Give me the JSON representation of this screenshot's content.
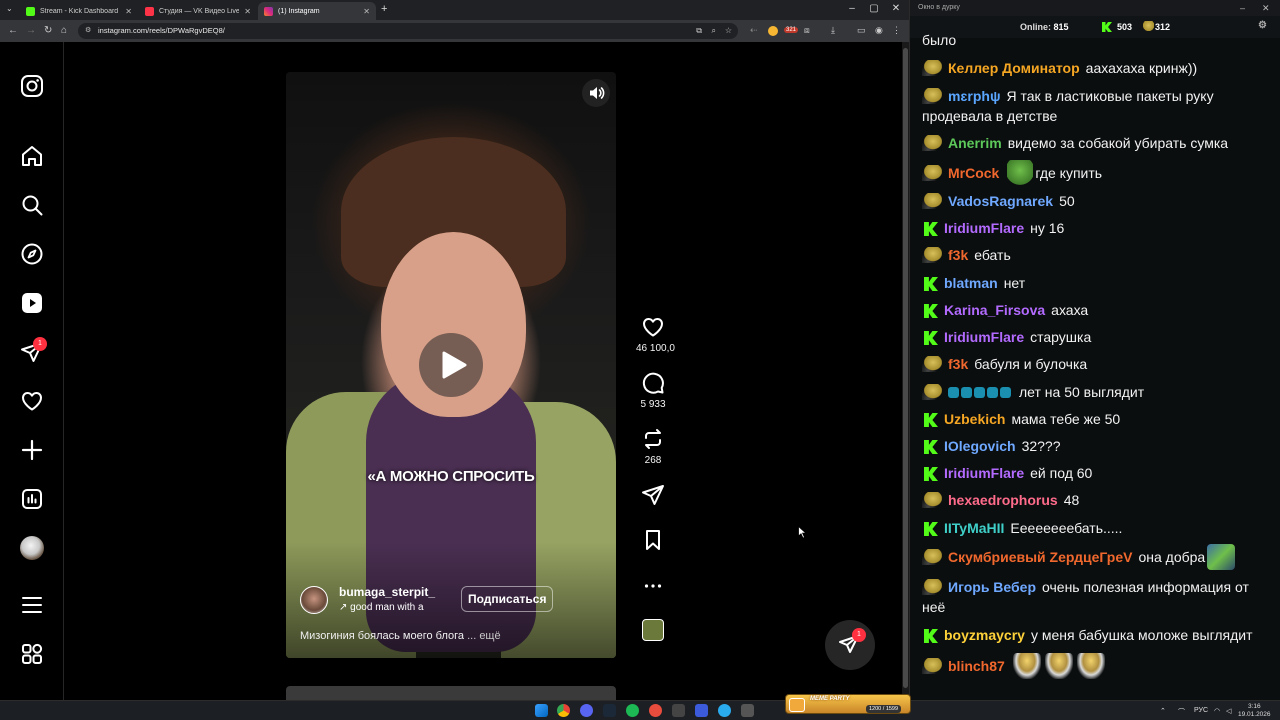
{
  "browser": {
    "tabs": [
      {
        "label": "Stream - Kick Dashboard",
        "color": "#53fc18"
      },
      {
        "label": "Студия — VK Видео Live",
        "color": "#ff3347"
      },
      {
        "label": "(1) Instagram",
        "color": "#e1306c"
      }
    ],
    "url": "instagram.com/reels/DPWaRgvDEQ8/",
    "ext_badge": "321"
  },
  "instagram": {
    "sidebar_badge": "1",
    "reel": {
      "overlay_text": "«А МОЖНО СПРОСИТЬ",
      "author": "bumaga_sterpit_",
      "audio": "good man with a",
      "follow_label": "Подписаться",
      "caption": "Мизогиния боялась моего блога",
      "caption_more": "... ещё"
    },
    "actions": {
      "likes": "46 100,0",
      "comments": "5 933",
      "reposts": "268"
    },
    "dm_badge": "1"
  },
  "chat": {
    "title": "Окно в дурку",
    "online_label": "Online:",
    "online_value": "815",
    "kick_count": "503",
    "vk_count": "312",
    "messages": [
      {
        "user": "",
        "text": "было",
        "icon": "none",
        "color": "#ffffff"
      },
      {
        "user": "Келлер Доминатор",
        "text": "аахахаха кринж))",
        "icon": "pepe",
        "color": "#f5a623"
      },
      {
        "user": "mɛrphψ",
        "text": "Я так в ластиковые пакеты руку продевала в детстве",
        "icon": "pepe",
        "color": "#5aa6ff"
      },
      {
        "user": "Anerrim",
        "text": "видемо за собакой убирать сумка",
        "icon": "pepe",
        "color": "#5cc95a"
      },
      {
        "user": "MrCock",
        "text": "где купить",
        "icon": "pepe",
        "color": "#f0682d"
      },
      {
        "user": "VadosRagnarek",
        "text": "50",
        "icon": "pepe",
        "color": "#6fa8ff"
      },
      {
        "user": "IridiumFlare",
        "text": "ну 16",
        "icon": "kick",
        "color": "#b36bff"
      },
      {
        "user": "f3k",
        "text": "ебать",
        "icon": "pepe",
        "color": "#f0682d"
      },
      {
        "user": "blatman",
        "text": "нет",
        "icon": "kick",
        "color": "#6fa8ff"
      },
      {
        "user": "Karina_Firsova",
        "text": "ахаха",
        "icon": "kick",
        "color": "#b36bff"
      },
      {
        "user": "IridiumFlare",
        "text": "старушка",
        "icon": "kick",
        "color": "#b36bff"
      },
      {
        "user": "f3k",
        "text": "бабуля и булочка",
        "icon": "pepe",
        "color": "#f0682d"
      },
      {
        "user": "",
        "text": "лет на 50 выглядит",
        "icon": "pepe",
        "color": "#1a8fb0"
      },
      {
        "user": "Uzbekich",
        "text": "мама тебе же 50",
        "icon": "kick",
        "color": "#f5a623"
      },
      {
        "user": "IOlegovich",
        "text": "32???",
        "icon": "kick",
        "color": "#6fa8ff"
      },
      {
        "user": "IridiumFlare",
        "text": "ей под 60",
        "icon": "kick",
        "color": "#b36bff"
      },
      {
        "user": "hexaedrophorus",
        "text": "48",
        "icon": "pepe",
        "color": "#ff6b8b"
      },
      {
        "user": "IITyMaHII",
        "text": "Еееееееебать.....",
        "icon": "kick",
        "color": "#3fd0c9"
      },
      {
        "user": "Скумбриевый ZердцеГреV",
        "text": "она добра",
        "icon": "pepe",
        "color": "#f0682d"
      },
      {
        "user": "Игорь Вебер",
        "text": "очень полезная информация от неё",
        "icon": "pepe",
        "color": "#6fa8ff"
      },
      {
        "user": "boyzmaycry",
        "text": "у меня бабушка моложе выглядит",
        "icon": "kick",
        "color": "#ffd23a"
      },
      {
        "user": "blinch87",
        "text": "",
        "icon": "pepe",
        "color": "#f0682d"
      }
    ]
  },
  "taskbar": {
    "lang": "РУС",
    "time": "3:16",
    "date": "19.01.2026",
    "meme_title": "MEME PARTY",
    "meme_value": "1200 / 1599"
  }
}
